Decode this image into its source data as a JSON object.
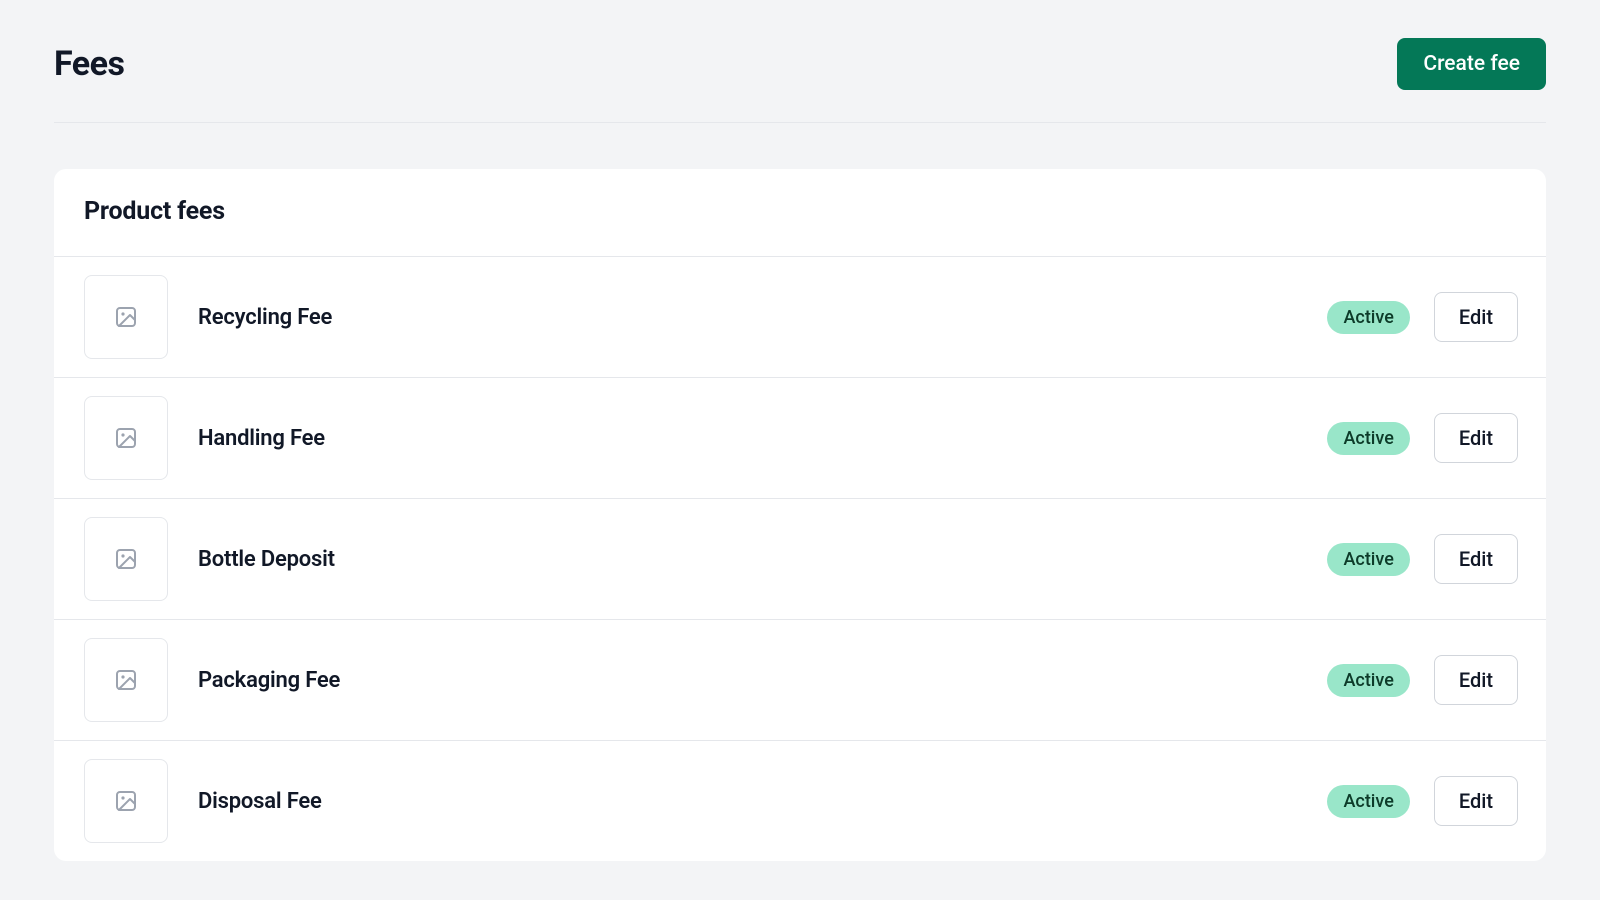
{
  "header": {
    "title": "Fees",
    "create_button": "Create fee"
  },
  "section": {
    "title": "Product fees"
  },
  "fees": [
    {
      "name": "Recycling Fee",
      "status": "Active",
      "edit_label": "Edit"
    },
    {
      "name": "Handling Fee",
      "status": "Active",
      "edit_label": "Edit"
    },
    {
      "name": "Bottle Deposit",
      "status": "Active",
      "edit_label": "Edit"
    },
    {
      "name": "Packaging Fee",
      "status": "Active",
      "edit_label": "Edit"
    },
    {
      "name": "Disposal Fee",
      "status": "Active",
      "edit_label": "Edit"
    }
  ],
  "icons": {
    "image_placeholder": "image-placeholder-icon"
  }
}
